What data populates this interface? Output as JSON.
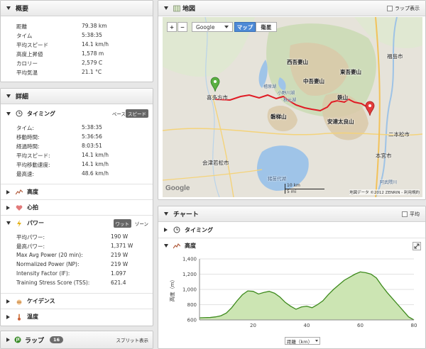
{
  "summary": {
    "title": "概要",
    "rows": [
      {
        "label": "距離",
        "value": "79.38 km"
      },
      {
        "label": "タイム",
        "value": "5:38:35"
      },
      {
        "label": "平均スピード",
        "value": "14.1 km/h"
      },
      {
        "label": "高度上昇値",
        "value": "1,578 m"
      },
      {
        "label": "カロリー",
        "value": "2,579 C"
      },
      {
        "label": "平均気温",
        "value": "21.1 °C"
      }
    ]
  },
  "details": {
    "title": "詳細",
    "timing": {
      "label": "タイミング",
      "toggle_pace": "ペース",
      "toggle_speed": "スピード",
      "rows": [
        {
          "label": "タイム:",
          "value": "5:38:35"
        },
        {
          "label": "移動時間:",
          "value": "5:36:56"
        },
        {
          "label": "経過時間:",
          "value": "8:03:51"
        },
        {
          "label": "平均スピード:",
          "value": "14.1 km/h"
        },
        {
          "label": "平均移動速度:",
          "value": "14.1 km/h"
        },
        {
          "label": "最高速:",
          "value": "48.6 km/h"
        }
      ]
    },
    "altitude_label": "高度",
    "heart_label": "心拍",
    "power": {
      "label": "パワー",
      "toggle_watts": "ワット",
      "toggle_zones": "ゾーン",
      "rows": [
        {
          "label": "平均パワー:",
          "value": "190 W"
        },
        {
          "label": "最高パワー:",
          "value": "1,371 W"
        },
        {
          "label": "Max Avg Power (20 min):",
          "value": "219 W"
        },
        {
          "label": "Normalized Power (NP):",
          "value": "219 W"
        },
        {
          "label": "Intensity Factor (IF):",
          "value": "1.097"
        },
        {
          "label": "Training Stress Score (TSS):",
          "value": "621.4"
        }
      ]
    },
    "cadence_label": "ケイデンス",
    "temperature_label": "温度"
  },
  "laps": {
    "title": "ラップ",
    "count": "16",
    "split_label": "スプリット表示"
  },
  "map": {
    "title": "地図",
    "lap_display_label": "ラップ表示",
    "zoom_in": "+",
    "zoom_out": "−",
    "provider_select": "Google",
    "type_map": "マップ",
    "type_satellite": "衛星",
    "labels": {
      "kitakata": "喜多方市",
      "nishiazuma": "西吾妻山",
      "nakaazuma": "中吾妻山",
      "higashiazuma": "東吾妻山",
      "fukushima": "福島市",
      "tetsuzan": "鉄山",
      "bandai": "磐梯山",
      "adatara": "安達太良山",
      "nihonmatsu": "二本松市",
      "motomiya": "本宮市",
      "aizuwakamatsu": "会津若松市",
      "inawashiro": "猪苗代湖",
      "hibara": "檜原湖",
      "onogawa": "小野川湖",
      "akimoto": "秋元湖",
      "abukuma": "阿武隈川"
    },
    "scale_km": "10 km",
    "scale_mi": "5 mi",
    "google_logo": "Google",
    "copyright": "地図データ ©2012 ZENRIN - 利用規約",
    "route_color": "#e01b24"
  },
  "chart": {
    "title": "チャート",
    "avg_label": "平均",
    "timing_label": "タイミング",
    "altitude_label": "高度",
    "xunit_select": "距離（km）"
  },
  "chart_data": {
    "type": "area",
    "title": "",
    "xlabel": "距離（km）",
    "ylabel": "高度（m）",
    "xlim": [
      0,
      80
    ],
    "ylim": [
      600,
      1400
    ],
    "xticks": [
      20,
      40,
      60,
      80
    ],
    "yticks": [
      600,
      800,
      1000,
      1200,
      1400
    ],
    "fill_color": "#cce5b3",
    "line_color": "#3d8a1c",
    "x": [
      0,
      2,
      4,
      6,
      8,
      10,
      12,
      14,
      16,
      18,
      20,
      22,
      24,
      26,
      28,
      30,
      32,
      34,
      36,
      38,
      40,
      42,
      44,
      46,
      48,
      50,
      52,
      54,
      56,
      58,
      60,
      62,
      64,
      66,
      68,
      70,
      72,
      74,
      76,
      78,
      80
    ],
    "y": [
      628,
      630,
      632,
      640,
      655,
      690,
      760,
      850,
      930,
      980,
      975,
      940,
      960,
      975,
      950,
      900,
      830,
      780,
      740,
      770,
      780,
      760,
      800,
      850,
      930,
      1000,
      1060,
      1120,
      1160,
      1200,
      1230,
      1220,
      1200,
      1150,
      1050,
      960,
      880,
      800,
      720,
      640,
      600
    ]
  }
}
